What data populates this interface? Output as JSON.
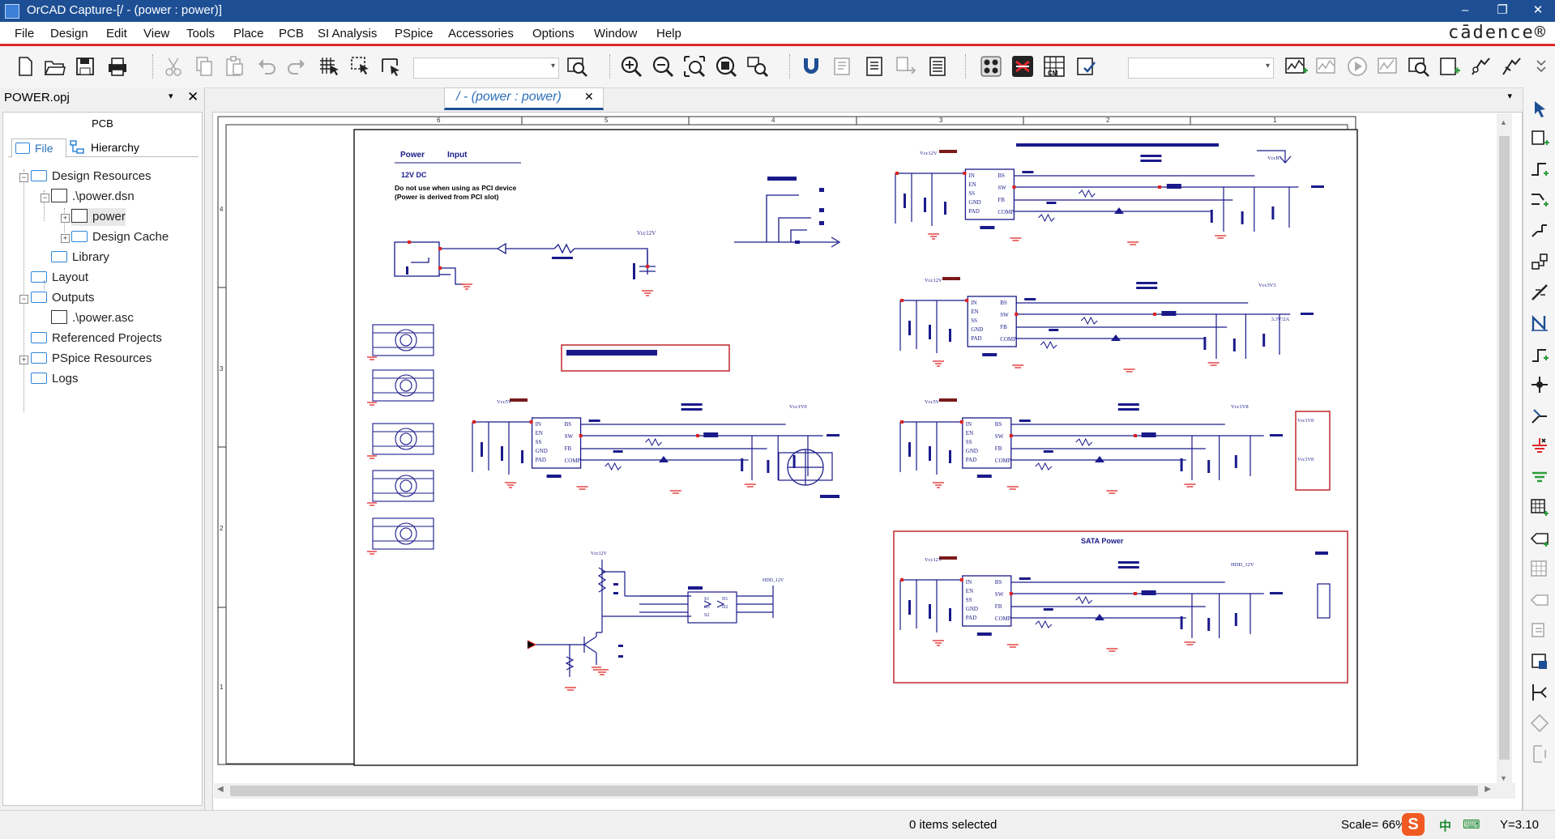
{
  "window": {
    "title": "OrCAD Capture-[/ - (power : power)]",
    "controls": [
      "–",
      "❐",
      "✕"
    ]
  },
  "brand": {
    "name": "cādence®"
  },
  "menu": [
    "File",
    "Design",
    "Edit",
    "View",
    "Tools",
    "Place",
    "PCB",
    "SI Analysis",
    "PSpice",
    "Accessories",
    "Options",
    "Window",
    "Help"
  ],
  "project": {
    "title": "POWER.opj",
    "pin_glyph": "▾",
    "close_glyph": "✕",
    "section_label": "PCB",
    "tabs": {
      "file": "File",
      "hierarchy": "Hierarchy"
    },
    "tree": [
      {
        "label": "Design Resources"
      },
      {
        "label": ".\\power.dsn"
      },
      {
        "label": "power"
      },
      {
        "label": "Design Cache"
      },
      {
        "label": "Library"
      },
      {
        "label": "Layout"
      },
      {
        "label": "Outputs"
      },
      {
        "label": ".\\power.asc"
      },
      {
        "label": "Referenced Projects"
      },
      {
        "label": "PSpice Resources"
      },
      {
        "label": "Logs"
      }
    ]
  },
  "document": {
    "tab_label": "/ - (power : power)",
    "tab_close": "✕",
    "overflow_glyph": "▾"
  },
  "schematic": {
    "border_cols": [
      "6",
      "5",
      "4",
      "3",
      "2",
      "1"
    ],
    "border_rows": [
      "4",
      "3",
      "2",
      "1"
    ],
    "header_power": "Power",
    "header_input": "Input",
    "input_voltage": "12V DC",
    "note_line1": "Do not use when using as PCI device",
    "note_line2": "(Power is derived from PCI slot)",
    "sata_title": "SATA Power",
    "net_labels": {
      "vcc12v": "Vcc12V",
      "vcc5v": "Vcc5V",
      "vcc3v3": "Vcc3V3",
      "vcc1v8": "Vcc1V8",
      "vcc1v0": "Vcc1V0",
      "vcc_r": "VccR",
      "hdd12v": "HDD_12V",
      "rating_3v3": "3.3V/2A"
    },
    "ic_pins_left": [
      "IN",
      "EN",
      "SS",
      "GND",
      "PAD"
    ],
    "ic_pins_right": [
      "BS",
      "SW",
      "FB",
      "COMP"
    ],
    "mosfet_pins": [
      "S1",
      "G1",
      "S2",
      "G2",
      "D1",
      "D2"
    ]
  },
  "status": {
    "message": "0 items selected",
    "scale": "Scale= 66%",
    "coord": "Y=3.10",
    "ime_logo": "S",
    "ime_lang": "中",
    "ime_kb": "⌨"
  }
}
